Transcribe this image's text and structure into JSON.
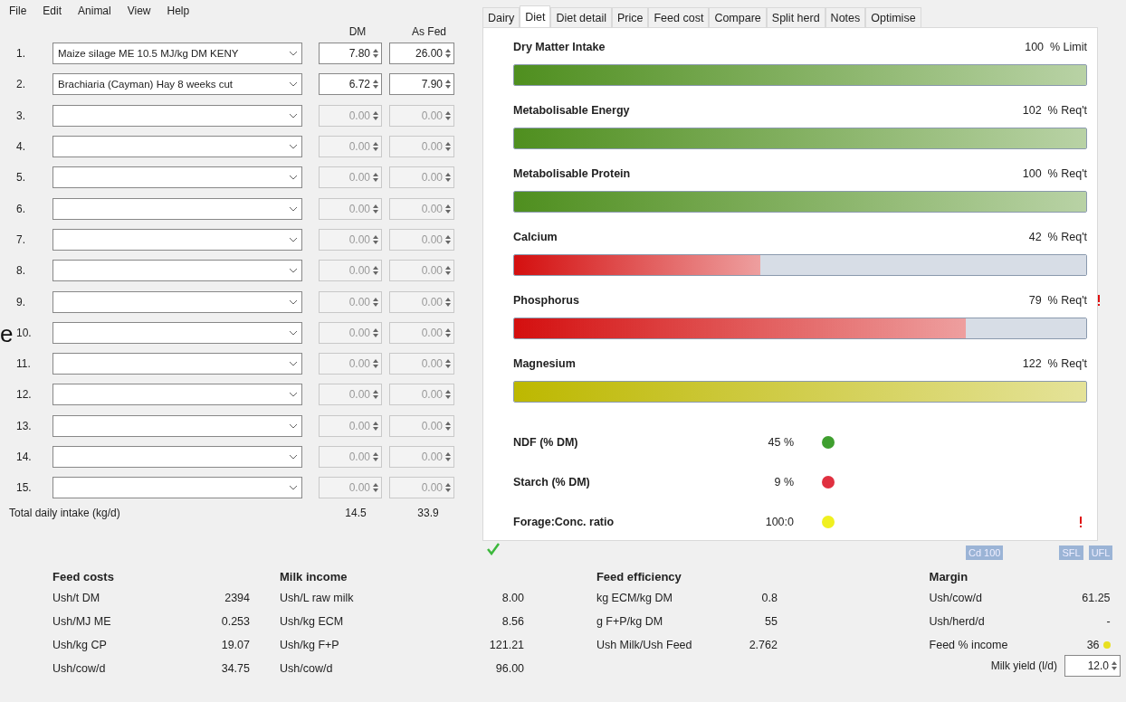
{
  "stray_text": "e",
  "menu": [
    "File",
    "Edit",
    "Animal",
    "View",
    "Help"
  ],
  "feed_table": {
    "columns": [
      "DM",
      "As Fed"
    ],
    "rows": [
      {
        "number": "1.",
        "feed": "Maize silage ME 10.5 MJ/kg DM KENY",
        "dm": "7.80",
        "as_fed": "26.00",
        "disabled": false
      },
      {
        "number": "2.",
        "feed": "Brachiaria (Cayman) Hay 8 weeks cut",
        "dm": "6.72",
        "as_fed": "7.90",
        "disabled": false
      },
      {
        "number": "3.",
        "dm": "0.00",
        "as_fed": "0.00",
        "disabled": true
      },
      {
        "number": "4.",
        "dm": "0.00",
        "as_fed": "0.00",
        "disabled": true
      },
      {
        "number": "5.",
        "dm": "0.00",
        "as_fed": "0.00",
        "disabled": true
      },
      {
        "number": "6.",
        "dm": "0.00",
        "as_fed": "0.00",
        "disabled": true
      },
      {
        "number": "7.",
        "dm": "0.00",
        "as_fed": "0.00",
        "disabled": true
      },
      {
        "number": "8.",
        "dm": "0.00",
        "as_fed": "0.00",
        "disabled": true
      },
      {
        "number": "9.",
        "dm": "0.00",
        "as_fed": "0.00",
        "disabled": true
      },
      {
        "number": "10.",
        "dm": "0.00",
        "as_fed": "0.00",
        "disabled": true
      },
      {
        "number": "11.",
        "dm": "0.00",
        "as_fed": "0.00",
        "disabled": true
      },
      {
        "number": "12.",
        "dm": "0.00",
        "as_fed": "0.00",
        "disabled": true
      },
      {
        "number": "13.",
        "dm": "0.00",
        "as_fed": "0.00",
        "disabled": true
      },
      {
        "number": "14.",
        "dm": "0.00",
        "as_fed": "0.00",
        "disabled": true
      },
      {
        "number": "15.",
        "dm": "0.00",
        "as_fed": "0.00",
        "disabled": true
      }
    ],
    "total": {
      "label": "Total daily intake (kg/d)",
      "dm": "14.5",
      "as_fed": "33.9"
    }
  },
  "tabs": [
    {
      "label": "Dairy",
      "selected": false
    },
    {
      "label": "Diet",
      "selected": true
    },
    {
      "label": "Diet detail",
      "selected": false
    },
    {
      "label": "Price",
      "selected": false
    },
    {
      "label": "Feed cost",
      "selected": false
    },
    {
      "label": "Compare",
      "selected": false
    },
    {
      "label": "Split herd",
      "selected": false
    },
    {
      "label": "Notes",
      "selected": false
    },
    {
      "label": "Optimise",
      "selected": false
    }
  ],
  "nutrients": [
    {
      "name": "Dry Matter Intake",
      "value": "100",
      "unit": "% Limit",
      "level": 1,
      "color": "#4f8f1f",
      "warning": false
    },
    {
      "name": "Metabolisable Energy",
      "value": "102",
      "unit": "% Req't",
      "level": 1,
      "color": "#4f8f1f",
      "warning": false
    },
    {
      "name": "Metabolisable Protein",
      "value": "100",
      "unit": "% Req't",
      "level": 1,
      "color": "#4f8f1f",
      "warning": false
    },
    {
      "name": "Calcium",
      "value": "42",
      "unit": "% Req't",
      "level": 0.43,
      "color": "#d40f0f",
      "warning": false
    },
    {
      "name": "Phosphorus",
      "value": "79",
      "unit": "% Req't",
      "level": 0.79,
      "color": "#d40f0f",
      "warning": true
    },
    {
      "name": "Magnesium",
      "value": "122",
      "unit": "% Req't",
      "level": 1,
      "color": "#bdb800",
      "warning": false
    }
  ],
  "indicators": [
    {
      "name": "NDF (% DM)",
      "value": "45 %",
      "color": "#3f9f2f"
    },
    {
      "name": "Starch (% DM)",
      "value": "9 %",
      "color": "#e03040"
    },
    {
      "name": "Forage:Conc. ratio",
      "value": "100:0",
      "color": "#f0f020"
    }
  ],
  "panel_warning": true,
  "ok": true,
  "badges": [
    "Cd 100",
    "SFL",
    "UFL"
  ],
  "summary": [
    {
      "title": "Feed costs",
      "rows": [
        {
          "label": "Ush/t DM",
          "value": "2394"
        },
        {
          "label": "Ush/MJ ME",
          "value": "0.253"
        },
        {
          "label": "Ush/kg CP",
          "value": "19.07"
        },
        {
          "label": "Ush/cow/d",
          "value": "34.75"
        }
      ]
    },
    {
      "title": "Milk income",
      "rows": [
        {
          "label": "Ush/L raw milk",
          "value": "8.00"
        },
        {
          "label": "Ush/kg ECM",
          "value": "8.56"
        },
        {
          "label": "Ush/kg F+P",
          "value": "121.21"
        },
        {
          "label": "Ush/cow/d",
          "value": "96.00"
        }
      ]
    },
    {
      "title": "Feed efficiency",
      "rows": [
        {
          "label": "kg ECM/kg DM",
          "value": "0.8"
        },
        {
          "label": "g F+P/kg DM",
          "value": "55"
        },
        {
          "label": "Ush Milk/Ush Feed",
          "value": "2.762"
        }
      ]
    },
    {
      "title": "Margin",
      "rows": [
        {
          "label": "Ush/cow/d",
          "value": "61.25"
        },
        {
          "label": "Ush/herd/d",
          "value": "-"
        },
        {
          "label": "Feed % income",
          "value": "36",
          "color": "#e8e020"
        }
      ]
    }
  ],
  "milk_yield": {
    "label": "Milk yield (l/d)",
    "value": "12.0"
  }
}
